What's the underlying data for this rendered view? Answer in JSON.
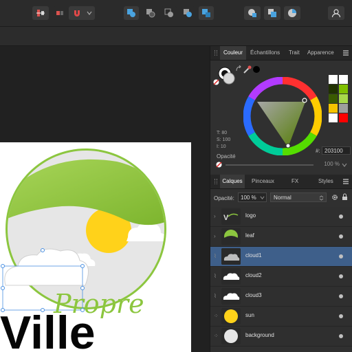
{
  "color_panel": {
    "tabs": [
      "Couleur",
      "Échantillons",
      "Trait",
      "Apparence"
    ],
    "hsl": {
      "t": "T: 80",
      "s": "S: 100",
      "l": "I: 10"
    },
    "hex_label": "#:",
    "hex_value": "203100",
    "opacity_label": "Opacité",
    "opacity_value": "100 %",
    "swatches": [
      "#ffffff",
      "#ffffff",
      "#203100",
      "#7fbf00",
      "#3a5a00",
      "#a8d84a",
      "#f5c400",
      "#9e9e9e",
      "#ffffff",
      "#ff0000"
    ]
  },
  "layers_panel": {
    "tabs": [
      "Calques",
      "Pinceaux",
      "FX",
      "Styles"
    ],
    "opacity_label": "Opacité:",
    "opacity_value": "100 %",
    "blend_mode": "Normal",
    "layers": [
      {
        "name": "logo",
        "selected": false
      },
      {
        "name": "leaf",
        "selected": false
      },
      {
        "name": "cloud1",
        "selected": true
      },
      {
        "name": "cloud2",
        "selected": false
      },
      {
        "name": "cloud3",
        "selected": false
      },
      {
        "name": "sun",
        "selected": false
      },
      {
        "name": "background",
        "selected": false
      }
    ]
  },
  "artwork": {
    "word_script": "Propre",
    "word_main": "Ville",
    "green": "#8cc63f",
    "sun": "#ffd21a"
  }
}
